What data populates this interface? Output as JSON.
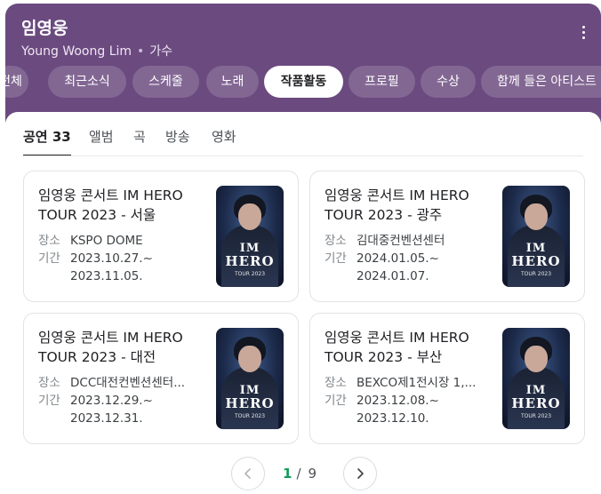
{
  "header": {
    "title": "임영웅",
    "subtitle_name": "Young Woong Lim",
    "subtitle_dot": "•",
    "subtitle_role": "가수"
  },
  "chips": [
    {
      "label": "전체"
    },
    {
      "label": "최근소식"
    },
    {
      "label": "스케줄"
    },
    {
      "label": "노래"
    },
    {
      "label": "작품활동",
      "active": true
    },
    {
      "label": "프로필"
    },
    {
      "label": "수상"
    },
    {
      "label": "함께 들은 아티스트"
    }
  ],
  "subtabs": [
    {
      "label": "공연 33",
      "active": true
    },
    {
      "label": "앨범"
    },
    {
      "label": "곡"
    },
    {
      "label": "방송"
    },
    {
      "label": "영화"
    }
  ],
  "labels": {
    "venue": "장소",
    "period": "기간"
  },
  "events": [
    {
      "title": "임영웅 콘서트 IM HERO TOUR 2023 - 서울",
      "venue": "KSPO DOME",
      "start": "2023.10.27.~",
      "end": "2023.11.05."
    },
    {
      "title": "임영웅 콘서트 IM HERO TOUR 2023 - 광주",
      "venue": "김대중컨벤션센터",
      "start": "2024.01.05.~",
      "end": "2024.01.07."
    },
    {
      "title": "임영웅 콘서트 IM HERO TOUR 2023 - 대전",
      "venue": "DCC대전컨벤션센터...",
      "start": "2023.12.29.~",
      "end": "2023.12.31."
    },
    {
      "title": "임영웅 콘서트 IM HERO TOUR 2023 - 부산",
      "venue": "BEXCO제1전시장 1,...",
      "start": "2023.12.08.~",
      "end": "2023.12.10."
    }
  ],
  "poster": {
    "logo_line1": "IM",
    "logo_line2": "HERO",
    "tour": "TOUR 2023"
  },
  "pagination": {
    "current": "1",
    "separator": "/",
    "total": "9"
  },
  "colors": {
    "header_bg": "#6b4a7f",
    "accent_green": "#0f9d58"
  }
}
